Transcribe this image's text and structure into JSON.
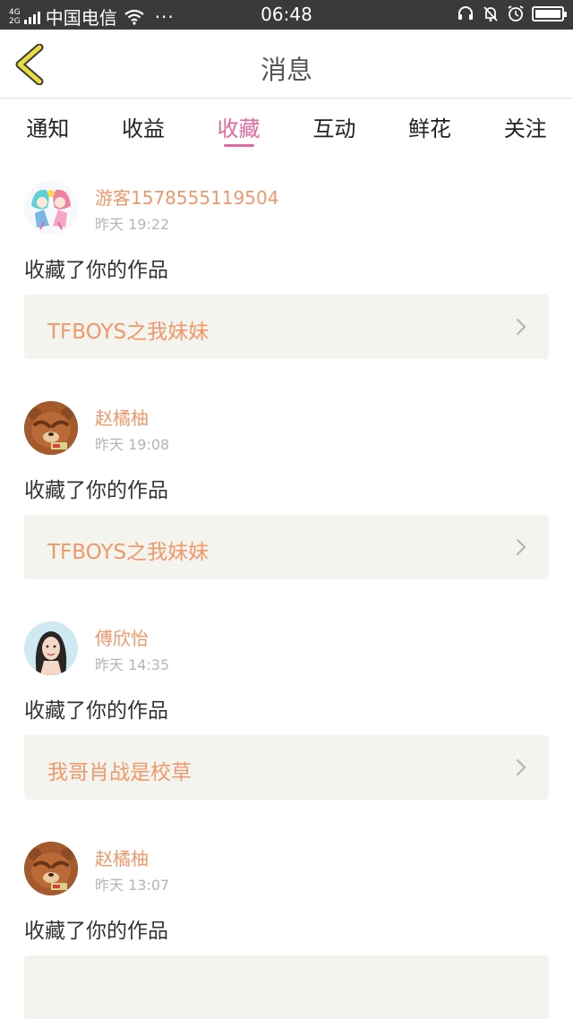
{
  "status_bar": {
    "net_type_top": "4G",
    "net_type_bottom": "2G",
    "carrier": "中国电信",
    "more": "···",
    "time": "06:48"
  },
  "header": {
    "title": "消息",
    "back_icon": "chevron-left-icon",
    "accent_color": "#e9dc3c"
  },
  "tabs": [
    {
      "label": "通知",
      "active": false
    },
    {
      "label": "收益",
      "active": false
    },
    {
      "label": "收藏",
      "active": true
    },
    {
      "label": "互动",
      "active": false
    },
    {
      "label": "鲜花",
      "active": false
    },
    {
      "label": "关注",
      "active": false
    }
  ],
  "colors": {
    "active_tab": "#e36a9e",
    "username": "#f0986a",
    "work_title": "#f0986a",
    "work_box_bg": "#f4f4ee"
  },
  "messages": [
    {
      "user": "游客1578555119504",
      "time": "昨天 19:22",
      "action": "收藏了你的作品",
      "work": "TFBOYS之我妹妹",
      "avatar": "anime-avatar"
    },
    {
      "user": "赵橘柚",
      "time": "昨天 19:08",
      "action": "收藏了你的作品",
      "work": "TFBOYS之我妹妹",
      "avatar": "bear-avatar"
    },
    {
      "user": "傅欣怡",
      "time": "昨天 14:35",
      "action": "收藏了你的作品",
      "work": "我哥肖战是校草",
      "avatar": "girl-photo-avatar"
    },
    {
      "user": "赵橘柚",
      "time": "昨天 13:07",
      "action": "收藏了你的作品",
      "work": "",
      "avatar": "bear-avatar"
    }
  ]
}
